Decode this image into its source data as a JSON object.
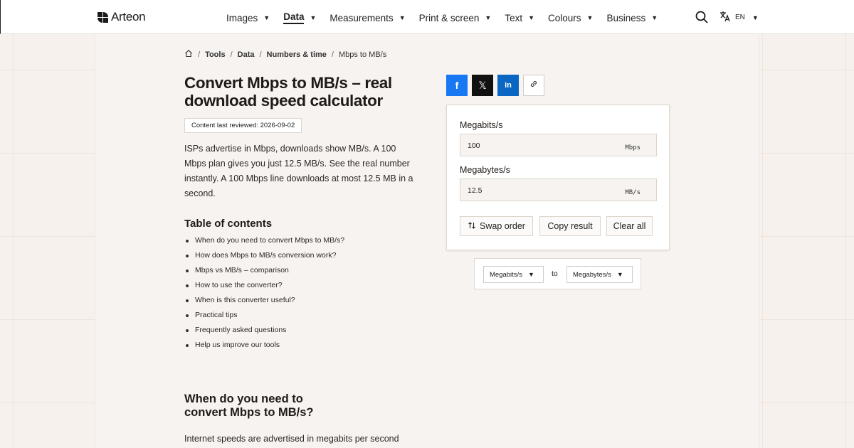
{
  "header": {
    "brand": "Arteon",
    "nav": [
      {
        "label": "Images"
      },
      {
        "label": "Data",
        "active": true
      },
      {
        "label": "Measurements"
      },
      {
        "label": "Print & screen"
      },
      {
        "label": "Text"
      },
      {
        "label": "Colours"
      },
      {
        "label": "Business"
      }
    ],
    "lang": "EN"
  },
  "breadcrumb": [
    "Tools",
    "Data",
    "Numbers & time",
    "Mbps to MB/s"
  ],
  "title": "Convert Mbps to MB/s – real download speed calculator",
  "review_badge": "Content last reviewed: 2026-09-02",
  "intro": "ISPs advertise in Mbps, downloads show MB/s. A 100 Mbps plan gives you just 12.5 MB/s. See the real number instantly. A 100 Mbps line downloads at most 12.5 MB in a second.",
  "toc": {
    "title": "Table of contents",
    "items": [
      "When do you need to convert Mbps to MB/s?",
      "How does Mbps to MB/s conversion work?",
      "Mbps vs MB/s – comparison",
      "How to use the converter?",
      "When is this converter useful?",
      "Practical tips",
      "Frequently asked questions",
      "Help us improve our tools"
    ]
  },
  "section": {
    "title": "When do you need to convert Mbps to MB/s?",
    "text": "Internet speeds are advertised in megabits per second"
  },
  "share": {
    "facebook": "f",
    "x": "𝕏",
    "linkedin": "in"
  },
  "converter": {
    "from_label": "Megabits/s",
    "from_value": "100",
    "from_unit": "Mbps",
    "to_label": "Megabytes/s",
    "to_value": "12.5",
    "to_unit": "MB/s",
    "swap": "Swap order",
    "copy": "Copy result",
    "clear": "Clear all"
  },
  "selectors": {
    "from": "Megabits/s",
    "connector": "to",
    "to": "Megabytes/s"
  },
  "colors": {
    "accent_facebook": "#1877f2",
    "accent_linkedin": "#0a66c2",
    "background": "#f6f1ed"
  }
}
